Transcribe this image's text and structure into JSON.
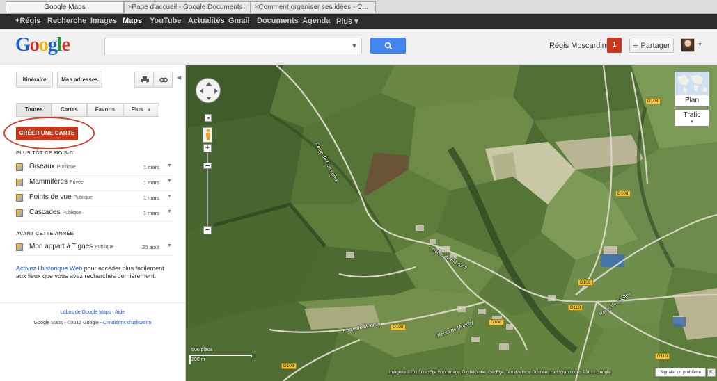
{
  "browser_tabs": [
    {
      "title": "Google Maps",
      "active": true
    },
    {
      "title": "Page d'accueil - Google Documents",
      "active": false
    },
    {
      "title": "Comment organiser ses idées - C...",
      "active": false
    }
  ],
  "gbar": {
    "items": [
      "+Régis",
      "Recherche",
      "Images",
      "Maps",
      "YouTube",
      "Actualités",
      "Gmail",
      "Documents",
      "Agenda",
      "Plus ▾"
    ],
    "selected": "Maps"
  },
  "header": {
    "logo_text": "Google",
    "search_value": "",
    "user_name": "Régis Moscardini",
    "notification_count": "1",
    "share_label": "Partager"
  },
  "panel": {
    "itinerary_label": "Itinéraire",
    "my_places_label": "Mes adresses",
    "tabs": [
      {
        "label": "Toutes",
        "selected": true
      },
      {
        "label": "Cartes",
        "selected": false
      },
      {
        "label": "Favoris",
        "selected": false
      },
      {
        "label": "Plus",
        "selected": false
      }
    ],
    "create_map_label": "CRÉER UNE CARTE",
    "section_recent": "PLUS TÔT CE MOIS-CI",
    "recent_maps": [
      {
        "name": "Oiseaux",
        "visibility": "Publique",
        "date": "1 mars"
      },
      {
        "name": "Mammifères",
        "visibility": "Privée",
        "date": "1 mars"
      },
      {
        "name": "Points de vue",
        "visibility": "Publique",
        "date": "1 mars"
      },
      {
        "name": "Cascades",
        "visibility": "Publique",
        "date": "1 mars"
      }
    ],
    "section_older": "AVANT CETTE ANNÉE",
    "older_maps": [
      {
        "name": "Mon appart à Tignes",
        "visibility": "Publique",
        "date": "20 août"
      }
    ],
    "history_link": "Activez l'historique Web",
    "history_text": " pour accéder plus facilement aux lieux que vous avez recherchés dernièrement.",
    "footer_labs": "Labos de Google Maps",
    "footer_sep": " - ",
    "footer_help": "Aide",
    "footer_copyright": "Google Maps - ©2012 Google - ",
    "footer_terms": "Conditions d'utilisation"
  },
  "map": {
    "road_labels": [
      "Route de Courcelles",
      "Route de Montlay",
      "Route de Montlay",
      "Route de Flavigny",
      "Route de Saulieu"
    ],
    "shields": [
      "D108",
      "D108",
      "D108",
      "D110",
      "D108",
      "D108",
      "D108",
      "D110"
    ],
    "plan_label": "Plan",
    "traffic_label": "Trafic",
    "scale_feet": "500 pieds",
    "scale_meters": "200 m",
    "copyright": "Imagerie ©2012 GeoEye Spot Image, DigitalGlobe, GeoEye, TerraMetrics, Données cartographiques ©2012 Google",
    "report_label": "Signaler un problème"
  },
  "colors": {
    "accent_blue": "#4585f0",
    "create_red": "#c8391c",
    "annotation_red": "#d33828",
    "link_blue": "#1a55cf"
  }
}
